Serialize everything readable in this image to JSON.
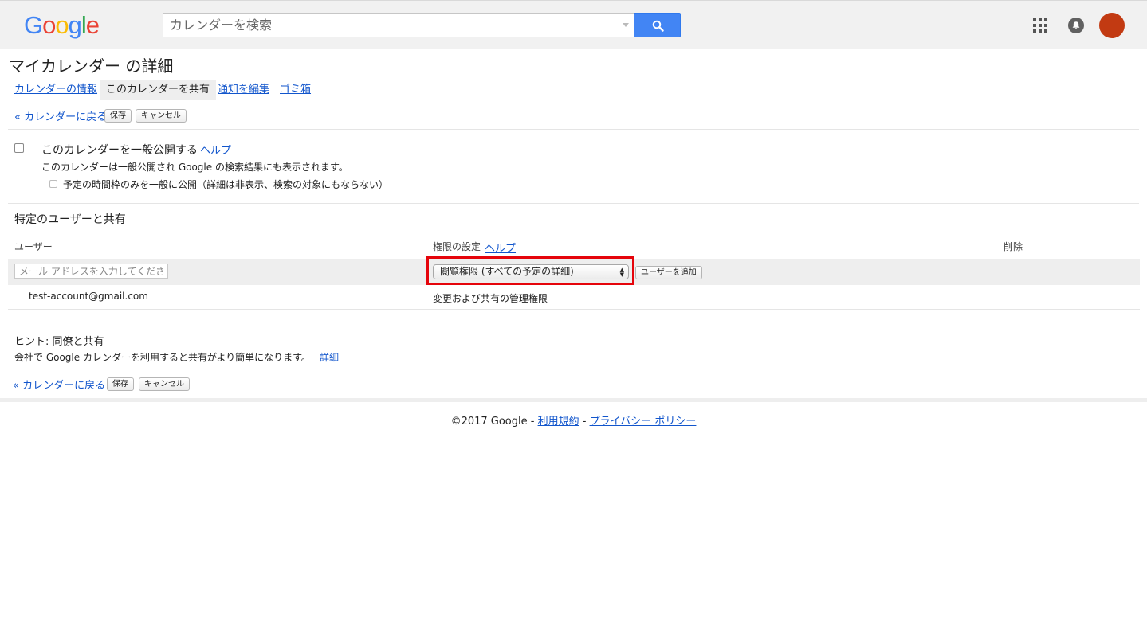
{
  "header": {
    "logo_letters": [
      {
        "ch": "G",
        "color": "#4285f4"
      },
      {
        "ch": "o",
        "color": "#ea4335"
      },
      {
        "ch": "o",
        "color": "#fbbc05"
      },
      {
        "ch": "g",
        "color": "#4285f4"
      },
      {
        "ch": "l",
        "color": "#34a853"
      },
      {
        "ch": "e",
        "color": "#ea4335"
      }
    ],
    "search_placeholder": "カレンダーを検索",
    "search_button_icon": "search-icon",
    "apps_icon": "apps-grid-icon",
    "notifications_icon": "notifications-icon",
    "avatar_color": "#c23a12"
  },
  "page": {
    "title": "マイカレンダー の詳細"
  },
  "tabs": [
    {
      "label": "カレンダーの情報",
      "active": false
    },
    {
      "label": "このカレンダーを共有",
      "active": true
    },
    {
      "label": "通知を編集",
      "active": false
    },
    {
      "label": "ゴミ箱",
      "active": false
    }
  ],
  "actions": {
    "back_label": "« カレンダーに戻る",
    "save_label": "保存",
    "cancel_label": "キャンセル"
  },
  "public_section": {
    "make_public_label": "このカレンダーを一般公開する",
    "help_label": "ヘルプ",
    "description": "このカレンダーは一般公開され Google の検索結果にも表示されます。",
    "freebusy_label": "予定の時間枠のみを一般に公開（詳細は非表示、検索の対象にもならない）",
    "make_public_checked": false,
    "freebusy_checked": false
  },
  "share_section": {
    "heading": "特定のユーザーと共有",
    "col_user": "ユーザー",
    "col_permission": "権限の設定",
    "col_permission_help": "ヘルプ",
    "col_delete": "削除",
    "email_placeholder": "メール アドレスを入力してくださ",
    "permission_selected": "閲覧権限 (すべての予定の詳細)",
    "add_user_label": "ユーザーを追加",
    "highlight_color": "#e5040b",
    "users": [
      {
        "email": "test-account@gmail.com",
        "permission": "変更および共有の管理権限"
      }
    ]
  },
  "hint": {
    "title": "ヒント: 同僚と共有",
    "body": "会社で Google カレンダーを利用すると共有がより簡単になります。",
    "details_label": "詳細"
  },
  "footer": {
    "copyright": "©2017 Google - ",
    "terms_label": "利用規約",
    "separator": " - ",
    "privacy_label": "プライバシー ポリシー"
  }
}
